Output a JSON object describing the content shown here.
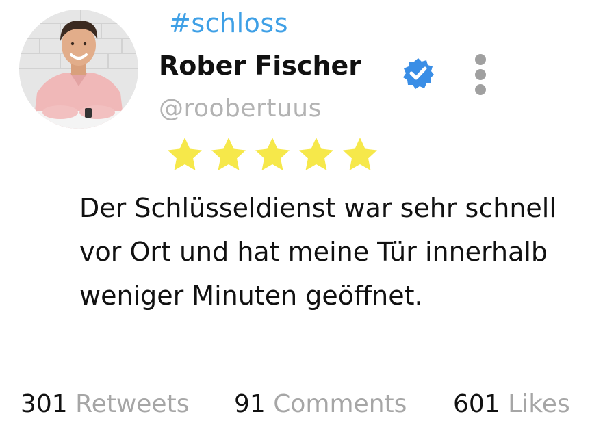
{
  "post": {
    "hashtag": "#schloss",
    "author_name": "Rober Fischer",
    "handle": "@roobertuus",
    "verified": true,
    "rating": {
      "value": 5,
      "max": 5
    },
    "text": "Der Schlüsseldienst war sehr schnell vor Ort und hat meine Tür innerhalb weniger Minuten geöffnet."
  },
  "stats": {
    "retweets": {
      "count": "301",
      "label": "Retweets"
    },
    "comments": {
      "count": "91",
      "label": "Comments"
    },
    "likes": {
      "count": "601",
      "label": "Likes"
    }
  },
  "icons": {
    "verified": "verified-badge-icon",
    "more": "more-vertical-icon",
    "star": "star-icon"
  },
  "colors": {
    "hashtag": "#3fa0e6",
    "verified": "#3a8ee6",
    "star": "#f6e84a",
    "handle": "#b3b3b3",
    "stat_label": "#a6a6a6",
    "more_dots": "#a0a0a0"
  }
}
